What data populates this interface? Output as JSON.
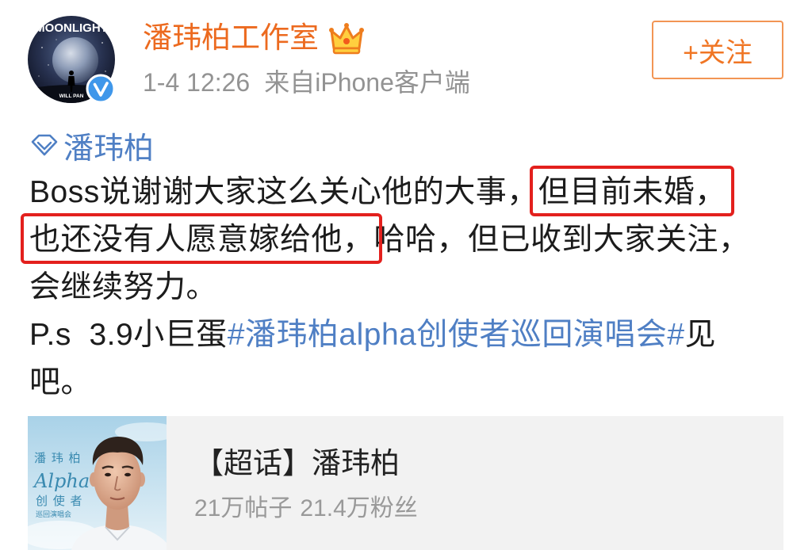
{
  "colors": {
    "username_orange": "#ec6a1f",
    "follow_orange": "#f07625",
    "link_blue": "#4f7fc4",
    "highlight_red": "#e3201d",
    "text": "#1c1c1c",
    "muted_gray": "#939393",
    "card_background": "#f2f2f2",
    "verified_blue": "#3f97ea"
  },
  "header": {
    "avatar": {
      "title": "MOONLIGHT",
      "caption": "WILL PAN",
      "badge_icon": "verified-v-icon"
    },
    "username": "潘玮柏工作室",
    "member_icon": "vip-crown-icon",
    "time": "1-4 12:26",
    "source_prefix": "来自",
    "source": "iPhone客户端",
    "follow_label": "+关注"
  },
  "post": {
    "topic_icon": "super-topic-diamond-icon",
    "topic": "潘玮柏",
    "lines": [
      [
        {
          "text": "Boss说谢谢大家这么关心他的大事，"
        },
        {
          "text": "但目前未婚，",
          "highlight": true
        }
      ],
      [
        {
          "text": "也还没有人愿意嫁给他，",
          "highlight": true
        },
        {
          "text": "哈哈，但已收到大家关注，"
        }
      ],
      [
        {
          "text": "会继续努力。"
        }
      ],
      [
        {
          "text": "P.s  3.9小巨蛋"
        },
        {
          "text": "#潘玮柏alpha创使者巡回演唱会#",
          "link": true
        },
        {
          "text": "见"
        }
      ],
      [
        {
          "text": "吧。"
        }
      ]
    ]
  },
  "card": {
    "poster": {
      "name": "潘 玮 柏",
      "album": "Alpha",
      "subtitle": "创 使 者",
      "tour": "巡回演唱会"
    },
    "title": "【超话】潘玮柏",
    "posts": "21万帖子",
    "fans": "21.4万粉丝"
  }
}
